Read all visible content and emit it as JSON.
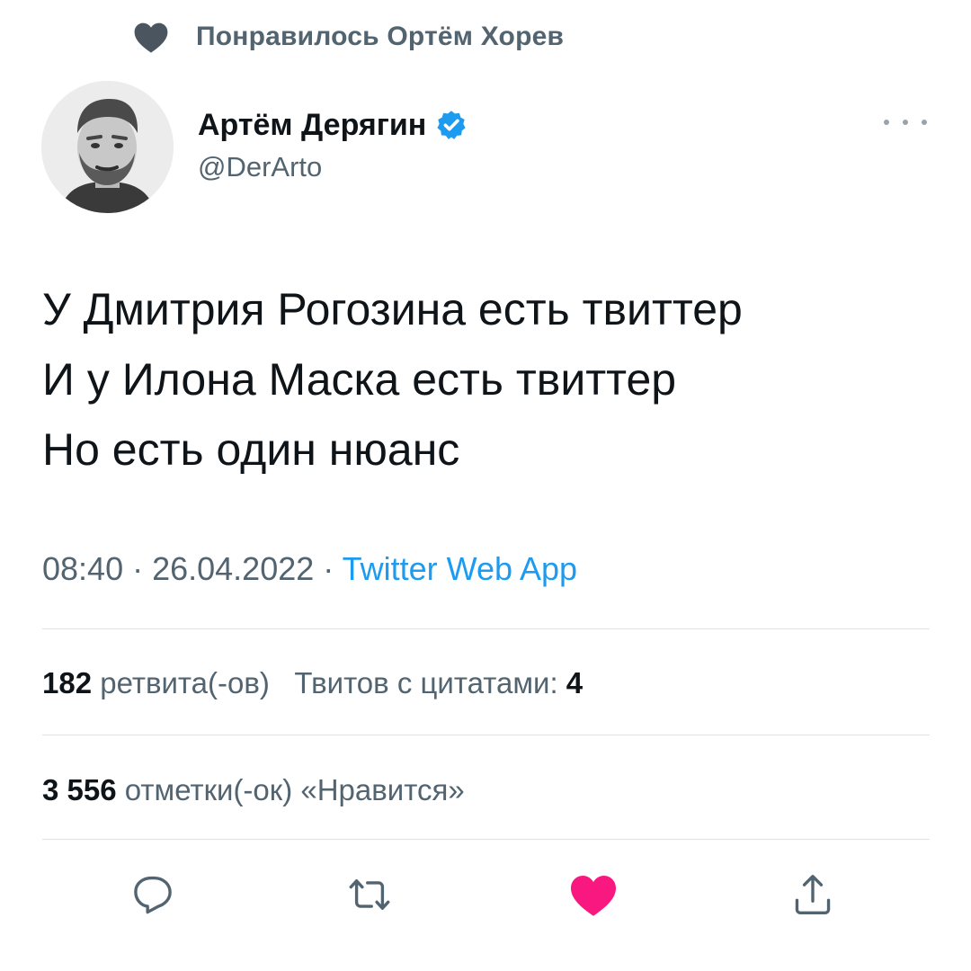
{
  "liked_by": {
    "icon": "heart-icon",
    "text": "Понравилось Ортём Хорев"
  },
  "author": {
    "name": "Артём Дерягин",
    "handle": "@DerArto",
    "verified_icon": "verified-badge-icon",
    "verified_color": "#1d9bf0"
  },
  "more_icon": "more-options-icon",
  "tweet": {
    "lines": [
      "У Дмитрия Рогозина есть твиттер",
      "И у Илона Маска есть твиттер",
      "Но есть один нюанс"
    ]
  },
  "meta": {
    "time": "08:40",
    "separator": " · ",
    "date": "26.04.2022",
    "source": "Twitter Web App"
  },
  "stats": {
    "retweets_count": "182",
    "retweets_label": "ретвита(-ов)",
    "quotes_label": "Твитов с цитатами:",
    "quotes_count": "4",
    "likes_count": "3 556",
    "likes_label": "отметки(-ок) «Нравится»"
  },
  "actions": {
    "reply_icon": "reply-icon",
    "retweet_icon": "retweet-icon",
    "like_icon": "heart-icon",
    "like_color": "#f91880",
    "share_icon": "share-icon"
  },
  "colors": {
    "secondary_text": "#536471",
    "link": "#1d9bf0",
    "liked_heart": "#4a5560"
  }
}
